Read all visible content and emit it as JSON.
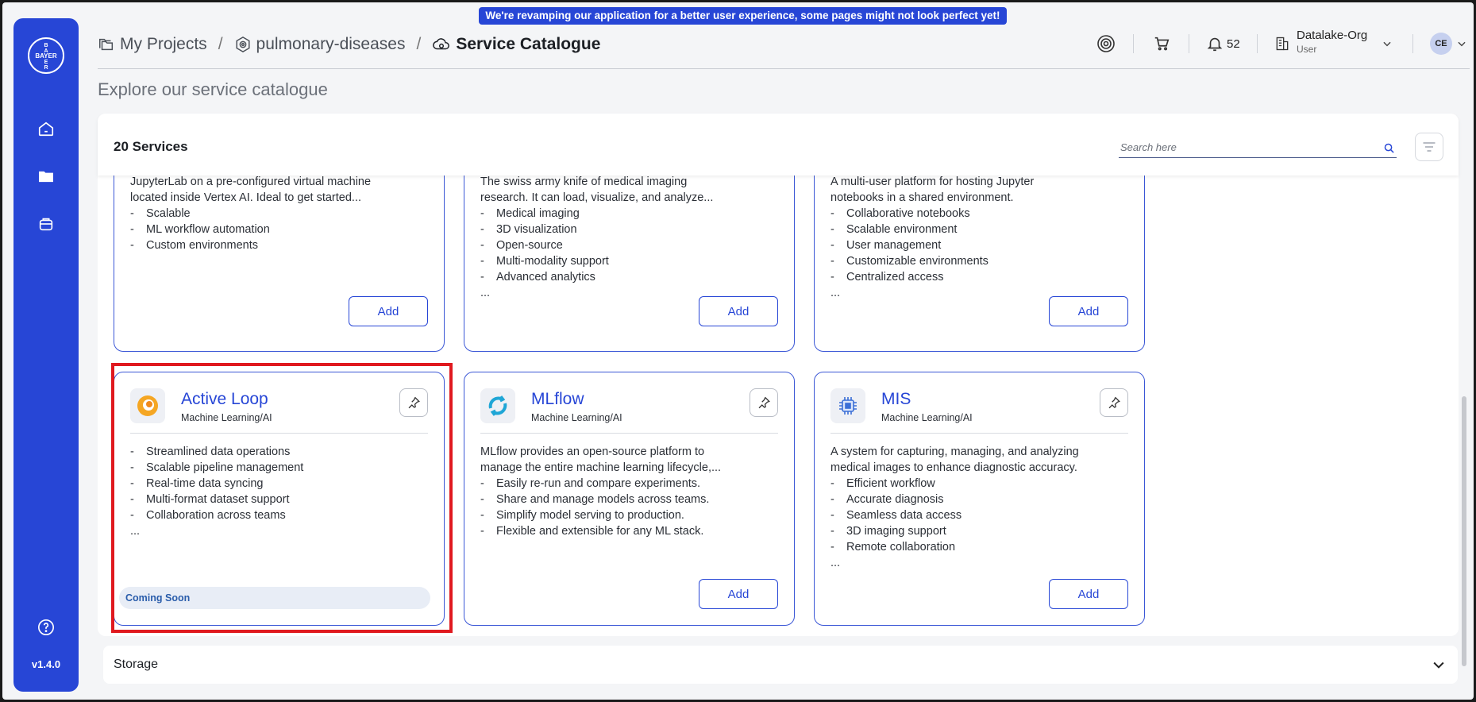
{
  "app": {
    "banner": "We're revamping our application for a better user experience, some pages might not look perfect yet!",
    "version": "v1.4.0",
    "logo_text": "BAYER"
  },
  "sidebar": {
    "items": [
      {
        "icon": "home-icon"
      },
      {
        "icon": "folder-icon"
      },
      {
        "icon": "bag-icon"
      }
    ],
    "help_icon": "help-icon"
  },
  "breadcrumb": {
    "items": [
      "My Projects",
      "pulmonary-diseases",
      "Service Catalogue"
    ],
    "separator": "/"
  },
  "header": {
    "notifications_count": "52",
    "org_name": "Datalake-Org",
    "org_role": "User",
    "avatar_initials": "CE"
  },
  "page": {
    "title": "Explore our service catalogue",
    "services_count": "20 Services",
    "search_placeholder": "Search here"
  },
  "cards_top": [
    {
      "desc": [
        "JupyterLab on a pre-configured virtual machine",
        "located inside Vertex AI. Ideal to get started..."
      ],
      "features": [
        "Scalable",
        "ML workflow automation",
        "Custom environments"
      ],
      "more": "",
      "add_label": "Add"
    },
    {
      "desc": [
        "The swiss army knife of medical imaging",
        "research. It can load, visualize, and analyze..."
      ],
      "features": [
        "Medical imaging",
        "3D visualization",
        "Open-source",
        "Multi-modality support",
        "Advanced analytics"
      ],
      "more": "...",
      "add_label": "Add"
    },
    {
      "desc": [
        "A multi-user platform for hosting Jupyter",
        "notebooks in a shared environment."
      ],
      "features": [
        "Collaborative notebooks",
        "Scalable environment",
        "User management",
        "Customizable environments",
        "Centralized access"
      ],
      "more": "...",
      "add_label": "Add"
    }
  ],
  "cards_bottom": [
    {
      "name": "Active Loop",
      "category": "Machine Learning/AI",
      "desc": [],
      "features": [
        "Streamlined data operations",
        "Scalable pipeline management",
        "Real-time data syncing",
        "Multi-format dataset support",
        "Collaboration across teams"
      ],
      "more": "...",
      "status": "Coming Soon"
    },
    {
      "name": "MLflow",
      "category": "Machine Learning/AI",
      "desc": [
        "MLflow provides an open-source platform to",
        "manage the entire machine learning lifecycle,..."
      ],
      "features": [
        "Easily re-run and compare experiments.",
        "Share and manage models across teams.",
        "Simplify model serving to production.",
        "Flexible and extensible for any ML stack."
      ],
      "more": "",
      "add_label": "Add"
    },
    {
      "name": "MIS",
      "category": "Machine Learning/AI",
      "desc": [
        "A system for capturing, managing, and analyzing",
        "medical images to enhance diagnostic accuracy."
      ],
      "features": [
        "Efficient workflow",
        "Accurate diagnosis",
        "Seamless data access",
        "3D imaging support",
        "Remote collaboration"
      ],
      "more": "...",
      "add_label": "Add"
    }
  ],
  "storage": {
    "label": "Storage"
  },
  "colors": {
    "primary": "#2746d6",
    "highlight": "#e0191f"
  }
}
